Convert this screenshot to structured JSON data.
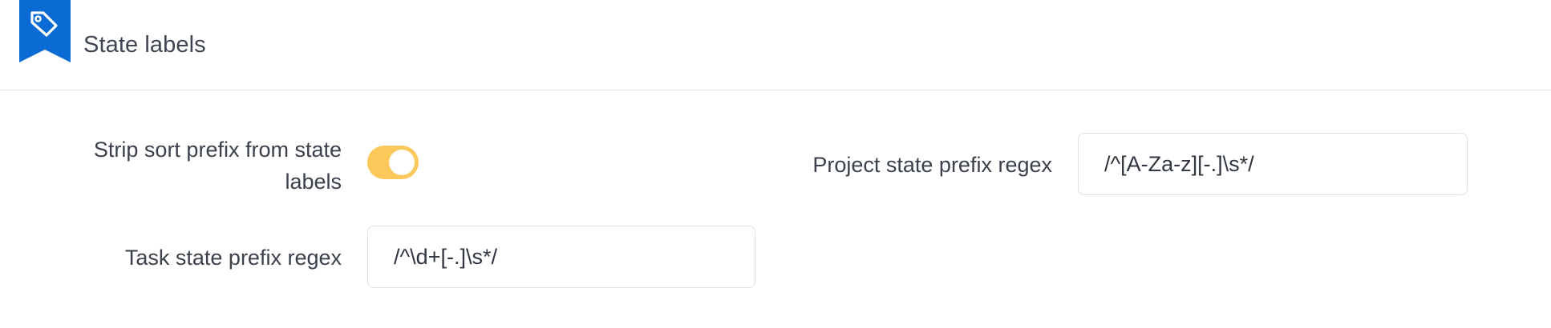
{
  "section": {
    "title": "State labels",
    "icon": "tag-icon",
    "accent_color": "#0b6bd4"
  },
  "settings": {
    "strip_prefix": {
      "label": "Strip sort prefix from state labels",
      "enabled": true,
      "toggle_color": "#fcc85a"
    },
    "task_prefix_regex": {
      "label": "Task state prefix regex",
      "value": "/^\\d+[-.]\\s*/"
    },
    "project_prefix_regex": {
      "label": "Project state prefix regex",
      "value": "/^[A-Za-z][-.]\\s*/"
    }
  }
}
